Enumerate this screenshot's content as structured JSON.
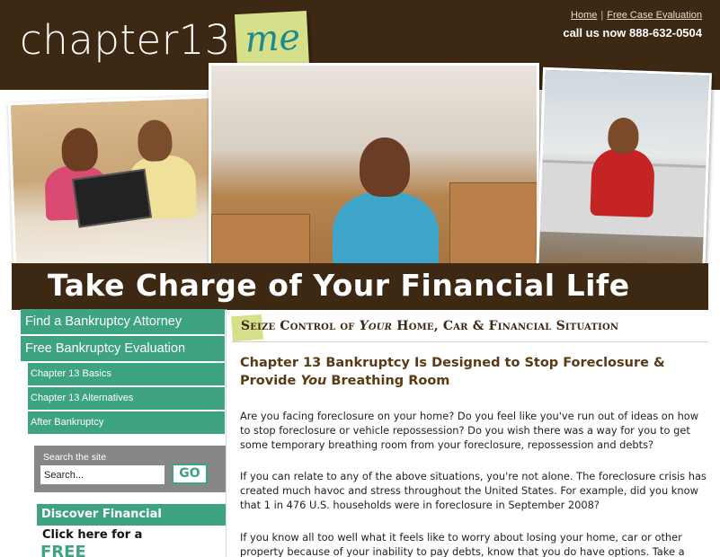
{
  "header": {
    "logo_text": "chapter13",
    "logo_note": "me",
    "links": {
      "home": "Home",
      "separator": "|",
      "free_case": "Free Case Evaluation"
    },
    "phone": "call us now 888-632-0504"
  },
  "hero": {
    "banner": "Take Charge of Your Financial Life"
  },
  "sidebar": {
    "main_items": [
      {
        "label": "Find a Bankruptcy Attorney"
      },
      {
        "label": "Free Bankruptcy Evaluation"
      }
    ],
    "sub_items": [
      {
        "label": "Chapter 13 Basics"
      },
      {
        "label": "Chapter 13 Alternatives"
      },
      {
        "label": "After Bankruptcy"
      }
    ],
    "search": {
      "label": "Search the site",
      "value": "Search...",
      "button": "GO"
    },
    "promo": {
      "heading": "Discover Financial Freedom.",
      "click": "Click here for a",
      "free": "FREE"
    }
  },
  "main": {
    "tagline_pre": "Seize Control of ",
    "tagline_em": "Your",
    "tagline_post": " Home, Car & Financial Situation",
    "headline_pre": "Chapter 13 Bankruptcy Is Designed to Stop Foreclosure & Provide ",
    "headline_em": "You",
    "headline_post": " Breathing Room",
    "paragraphs": [
      "Are you facing foreclosure on your home? Do you feel like you've run out of ideas on how to stop foreclosure or vehicle repossession? Do you wish there was a way for you to get some temporary breathing room from your foreclosure, repossession and debts?",
      "If you can relate to any of the above situations, you're not alone. The foreclosure crisis has created much havoc and stress throughout the United States. For example, did you know that 1 in 476 U.S. households were in foreclosure in September 2008?",
      "If you know all too well what it feels like to worry about losing your home, car or other property because of your inability to pay debts, know that you do have options. Take a"
    ]
  },
  "colors": {
    "brown": "#3d2814",
    "green": "#3ea382",
    "note": "#d6e08a"
  }
}
